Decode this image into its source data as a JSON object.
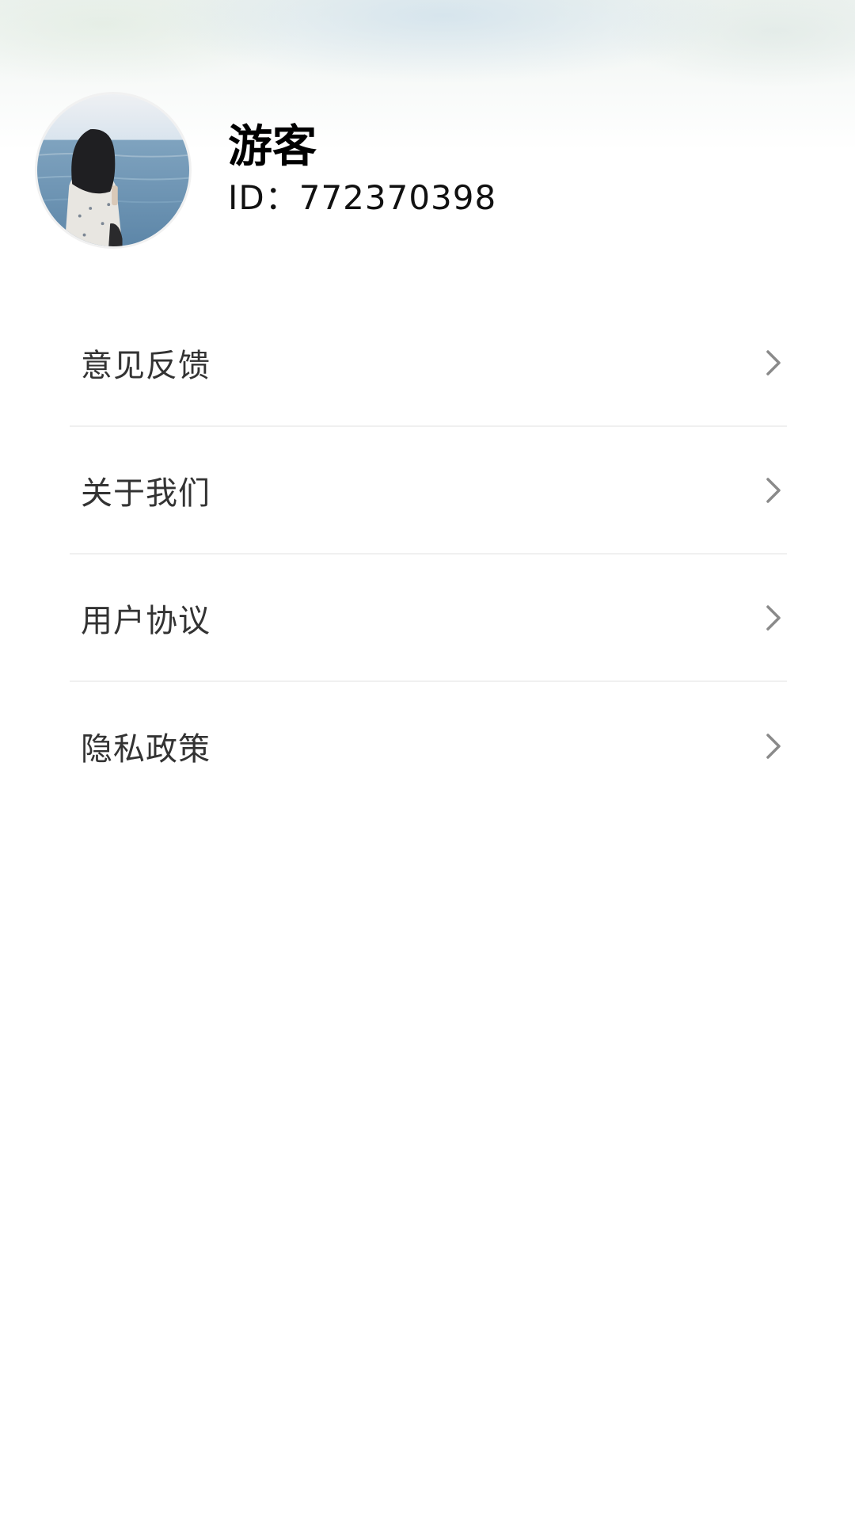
{
  "profile": {
    "name": "游客",
    "id_text": "ID：772370398",
    "avatar_icon": "avatar-photo"
  },
  "menu": {
    "items": [
      {
        "label": "意见反馈",
        "icon": "chevron-right-icon"
      },
      {
        "label": "关于我们",
        "icon": "chevron-right-icon"
      },
      {
        "label": "用户协议",
        "icon": "chevron-right-icon"
      },
      {
        "label": "隐私政策",
        "icon": "chevron-right-icon"
      }
    ]
  },
  "colors": {
    "text_primary": "#000000",
    "text_menu": "#333333",
    "divider": "#f0f0f0",
    "chevron": "#8a8a8a"
  }
}
